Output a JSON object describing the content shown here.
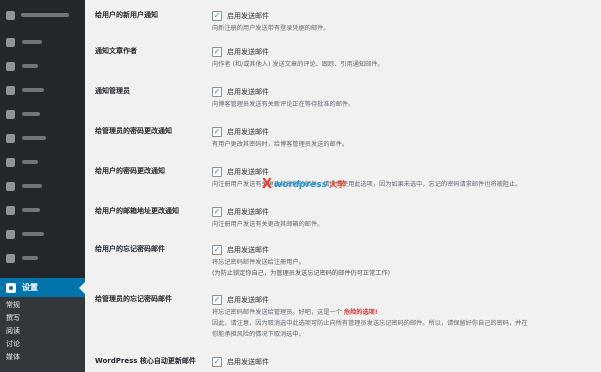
{
  "sidebar": {
    "active_item": {
      "label": "设置",
      "icon": "settings-icon"
    },
    "submenu": [
      {
        "label": "常规"
      },
      {
        "label": "撰写"
      },
      {
        "label": "阅读"
      },
      {
        "label": "讨论"
      },
      {
        "label": "媒体"
      }
    ],
    "colors": {
      "background": "#23282d",
      "active": "#0073aa",
      "submenu": "#32373c"
    }
  },
  "rows": [
    {
      "label": "给用户的新用户通知",
      "checkbox_label": "启用发送邮件",
      "checked": true,
      "description": [
        "向新注册的用户发送带有登录凭据的邮件。"
      ]
    },
    {
      "label": "通知文章作者",
      "checkbox_label": "启用发送邮件",
      "checked": true,
      "description": [
        "向作者 (和/或其他人) 发送文章的评论、跟踪、引用通知邮件。"
      ]
    },
    {
      "label": "通知管理员",
      "checkbox_label": "启用发送邮件",
      "checked": true,
      "description": [
        "向博客管理员发送有关新评论正在等待批准的邮件。"
      ]
    },
    {
      "label": "给管理员的密码更改通知",
      "checkbox_label": "启用发送邮件",
      "checked": true,
      "description": [
        "有用户更改其密码时，给博客管理员发送的邮件。"
      ]
    },
    {
      "label": "给用户的密码更改通知",
      "checkbox_label": "启用发送邮件",
      "checked": true,
      "description": [
        "向注册用户发送有关更改其密码的邮件。请谨慎使用此选项，因为如果未选中，忘记的密码请求邮件也将被阻止。"
      ]
    },
    {
      "label": "给用户的邮箱地址更改通知",
      "checkbox_label": "启用发送邮件",
      "checked": true,
      "description": [
        "向注册用户发送有关更改其邮箱的邮件。"
      ]
    },
    {
      "label": "给用户的忘记密码邮件",
      "checkbox_label": "启用发送邮件",
      "checked": true,
      "description": [
        "将忘记密码邮件发送给注册用户。",
        "(为防止锁定你自己，为管理员发送忘记密码的邮件仍可正常工作)"
      ]
    },
    {
      "label": "给管理员的忘记密码邮件",
      "checkbox_label": "启用发送邮件",
      "checked": true,
      "description_prefix": "将忘记密码邮件发送给管理员。好吧，这是一个",
      "description_danger": "危险的选项!",
      "description": [
        "因此，请注意，因为取消选中此选项可防止向所有管理员发送忘记密码的邮件。所以，请保留好你自己的密码，并在",
        "你能承担风险的情况下取消选中。"
      ]
    },
    {
      "label": "WordPress 核心自动更新邮件",
      "checkbox_label": "启用发送邮件",
      "checked": true,
      "description": []
    }
  ],
  "watermark": {
    "mark": "X",
    "brand": "wordpress",
    "suffix": "大学"
  },
  "colors": {
    "page_background": "#f1f1f1",
    "checkmark": "#1e8cbe",
    "danger": "#d63638"
  }
}
